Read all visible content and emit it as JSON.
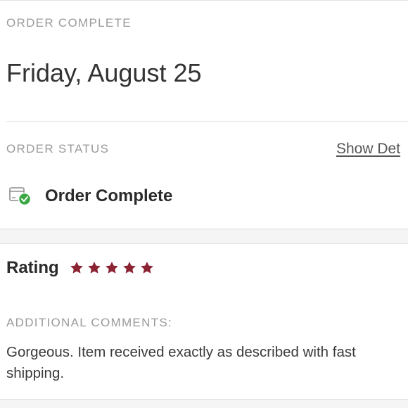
{
  "order": {
    "header_label": "ORDER COMPLETE",
    "date": "Friday, August 25"
  },
  "status": {
    "section_label": "ORDER STATUS",
    "show_details_link": "Show Det",
    "status_text": "Order Complete",
    "status_icon": "package-check-icon",
    "check_color": "#3aa845"
  },
  "review": {
    "rating_label": "Rating",
    "rating_value": 5,
    "rating_max": 5,
    "star_color": "#8b2332",
    "comments_label": "ADDITIONAL COMMENTS:",
    "comments_text": "Gorgeous. Item received exactly as described with fast shipping."
  }
}
